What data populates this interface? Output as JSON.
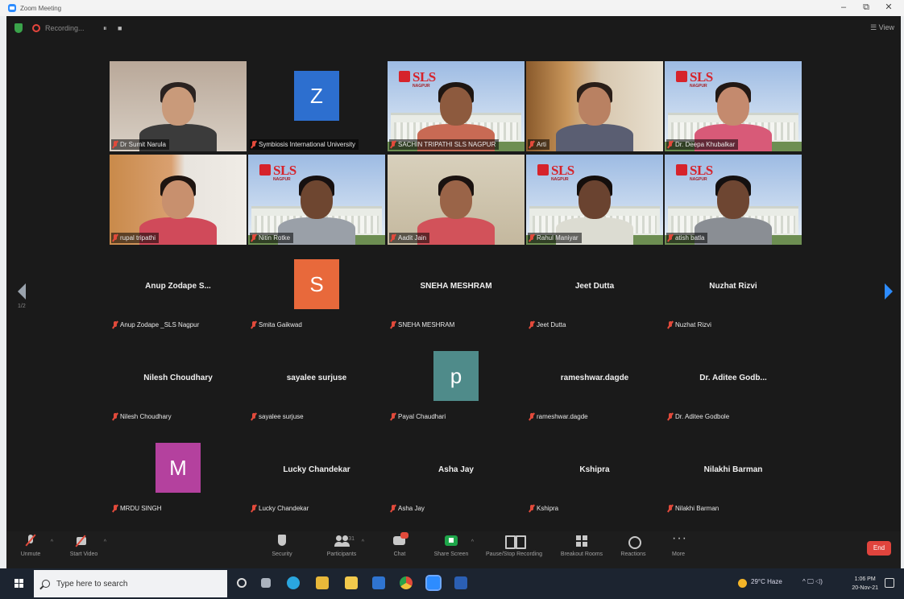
{
  "window": {
    "title": "Zoom Meeting",
    "min": "–",
    "restore": "⧉",
    "close": "✕"
  },
  "top": {
    "recording_text": "Recording...",
    "pause": "⏸",
    "stop": "■",
    "view_label": "View"
  },
  "video_tiles": [
    {
      "name": "Dr Sumit Narula",
      "bg": "wall",
      "skin": "#c99a7a",
      "hair": "#2a2220",
      "shirt": "#3b3b3b",
      "speaking": true
    },
    {
      "name": "Symbiosis International University",
      "avatar_letter": "Z",
      "avatar_color": "#2d6fcf"
    },
    {
      "name": "SACHIN TRIPATHI SLS NAGPUR",
      "bg": "sls",
      "skin": "#8d5a3e",
      "hair": "#1e1612",
      "shirt": "#c86a54"
    },
    {
      "name": "Arti",
      "bg": "art",
      "skin": "#b98162",
      "hair": "#2a1e18",
      "shirt": "#5a5e72"
    },
    {
      "name": "Dr. Deepa Khubalkar",
      "bg": "sls",
      "skin": "#c48a6e",
      "hair": "#221814",
      "shirt": "#d85a78"
    },
    {
      "name": "rupal tripathi",
      "bg": "orange",
      "skin": "#c8906e",
      "hair": "#1e1410",
      "shirt": "#d04a5a"
    },
    {
      "name": "Nitin Rotke",
      "bg": "sls",
      "skin": "#6e4630",
      "hair": "#161010",
      "shirt": "#9aa0a8"
    },
    {
      "name": "Aadit Jain",
      "bg": "beige",
      "skin": "#9a6448",
      "hair": "#1a1210",
      "shirt": "#d2525a"
    },
    {
      "name": "Rahul Maniyar",
      "bg": "sls",
      "skin": "#6a4330",
      "hair": "#140e0c",
      "shirt": "#dcdcd2"
    },
    {
      "name": "atish batla",
      "bg": "sls",
      "skin": "#6e4632",
      "hair": "#141010",
      "shirt": "#8a8e94"
    }
  ],
  "name_tiles": [
    {
      "display": "Anup Zodape  S...",
      "label": "Anup Zodape _SLS Nagpur"
    },
    {
      "display": "",
      "label": "Smita Gaikwad",
      "avatar_letter": "S",
      "avatar_color": "#e8693b"
    },
    {
      "display": "SNEHA MESHRAM",
      "label": "SNEHA MESHRAM"
    },
    {
      "display": "Jeet Dutta",
      "label": "Jeet Dutta"
    },
    {
      "display": "Nuzhat Rizvi",
      "label": "Nuzhat Rizvi"
    },
    {
      "display": "Nilesh Choudhary",
      "label": "Nilesh Choudhary"
    },
    {
      "display": "sayalee surjuse",
      "label": "sayalee surjuse"
    },
    {
      "display": "",
      "label": "Payal Chaudhari",
      "avatar_letter": "p",
      "avatar_color": "#4f8b8a"
    },
    {
      "display": "rameshwar.dagde",
      "label": "rameshwar.dagde"
    },
    {
      "display": "Dr. Aditee Godb...",
      "label": "Dr. Aditee Godbole"
    },
    {
      "display": "",
      "label": "MRDU SINGH",
      "avatar_letter": "M",
      "avatar_color": "#b4419e"
    },
    {
      "display": "Lucky Chandekar",
      "label": "Lucky Chandekar"
    },
    {
      "display": "Asha Jay",
      "label": "Asha Jay"
    },
    {
      "display": "Kshipra",
      "label": "Kshipra"
    },
    {
      "display": "Nilakhi Barman",
      "label": "Nilakhi Barman"
    }
  ],
  "sls_logo": {
    "text": "SLS",
    "sub": "NAGPUR"
  },
  "toolbar": {
    "unmute": "Unmute",
    "start_video": "Start Video",
    "security": "Security",
    "participants": "Participants",
    "participants_count": "31",
    "chat": "Chat",
    "share_screen": "Share Screen",
    "pause_recording": "Pause/Stop Recording",
    "breakout": "Breakout Rooms",
    "reactions": "Reactions",
    "more": "More",
    "end": "End"
  },
  "taskbar": {
    "search_placeholder": "Type here to search",
    "weather": "29°C  Haze",
    "tray_symbols": "^  🖵  ◁)",
    "time": "1:06 PM",
    "date": "20-Nov-21"
  }
}
